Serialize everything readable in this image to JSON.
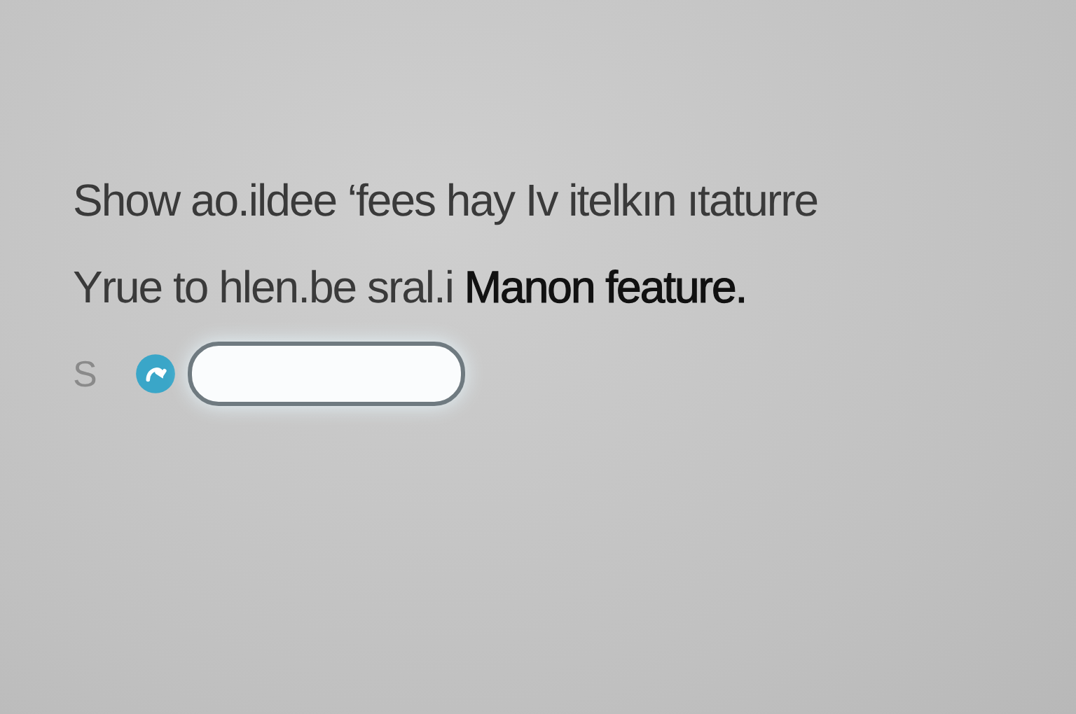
{
  "message": [
    "Show ao.ildee ‘fees hay  Iv itelkın ıtaturre",
    "Yrue to  hlen.be sral.i **Manon feature.**"
  ],
  "row": {
    "label": "S"
  }
}
